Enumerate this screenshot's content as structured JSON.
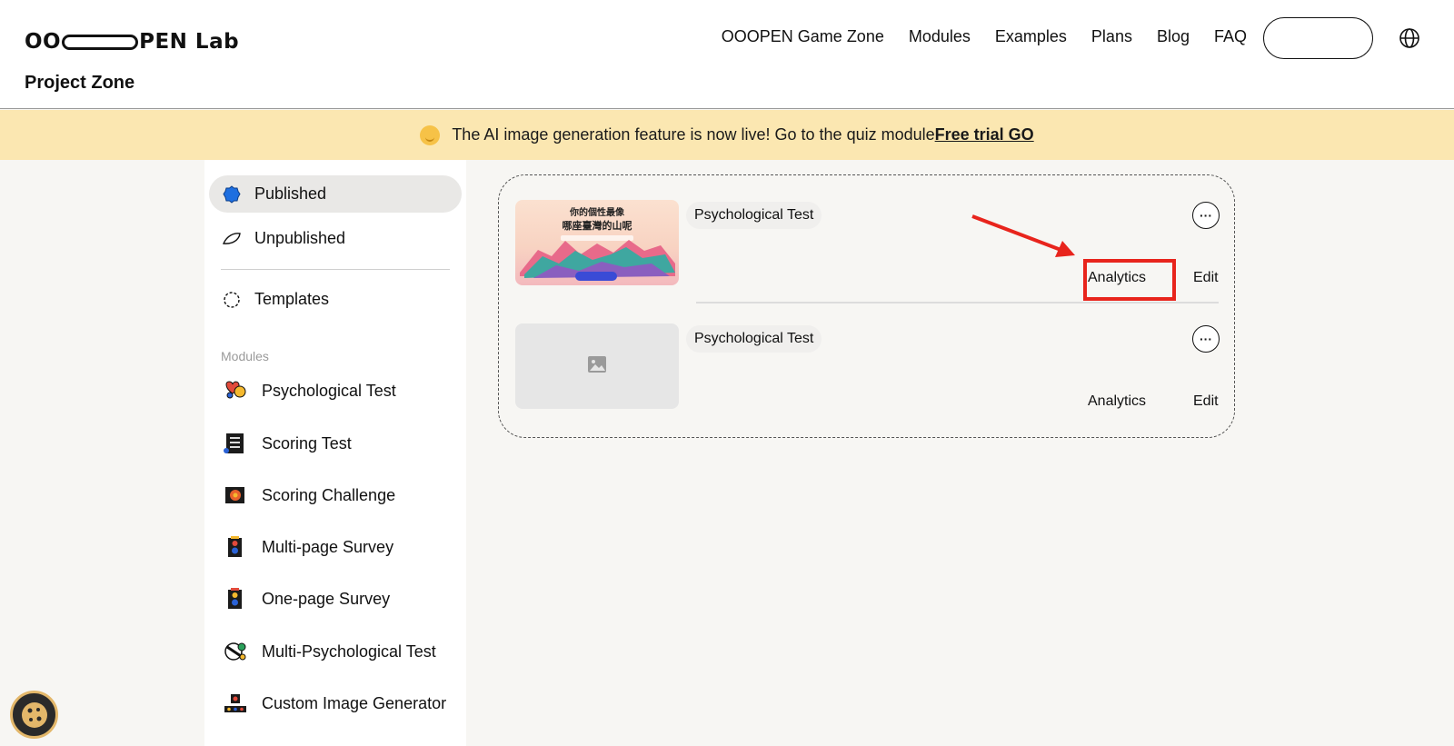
{
  "header": {
    "logo": {
      "left": "OO",
      "right": "PEN Lab"
    },
    "subtitle": "Project Zone",
    "nav": [
      "OOOPEN Game Zone",
      "Modules",
      "Examples",
      "Plans",
      "Blog",
      "FAQ"
    ]
  },
  "banner": {
    "message": "The AI image generation feature is now live! Go to the quiz module",
    "link": "Free trial GO"
  },
  "sidebar": {
    "items": [
      {
        "label": "Published",
        "icon": "published-icon",
        "active": true
      },
      {
        "label": "Unpublished",
        "icon": "unpublished-icon",
        "active": false
      },
      {
        "label": "Templates",
        "icon": "templates-icon",
        "active": false
      }
    ],
    "modules_label": "Modules",
    "modules": [
      {
        "label": "Psychological Test",
        "icon": "psychological-test-icon"
      },
      {
        "label": "Scoring Test",
        "icon": "scoring-test-icon"
      },
      {
        "label": "Scoring Challenge",
        "icon": "scoring-challenge-icon"
      },
      {
        "label": "Multi-page Survey",
        "icon": "multi-page-survey-icon"
      },
      {
        "label": "One-page Survey",
        "icon": "one-page-survey-icon"
      },
      {
        "label": "Multi-Psychological Test",
        "icon": "multi-psychological-test-icon"
      },
      {
        "label": "Custom Image Generator",
        "icon": "custom-image-generator-icon"
      }
    ]
  },
  "projects": [
    {
      "tag": "Psychological Test",
      "thumb_text": [
        "你的個性最像",
        "哪座臺灣的山呢"
      ],
      "analytics": "Analytics",
      "edit": "Edit",
      "more": "···"
    },
    {
      "tag": "Psychological Test",
      "thumb_text": [],
      "analytics": "Analytics",
      "edit": "Edit",
      "more": "···"
    }
  ],
  "colors": {
    "banner_bg": "#fbe7b1",
    "highlight": "#e8241c",
    "active_item_bg": "#e9e8e6"
  }
}
